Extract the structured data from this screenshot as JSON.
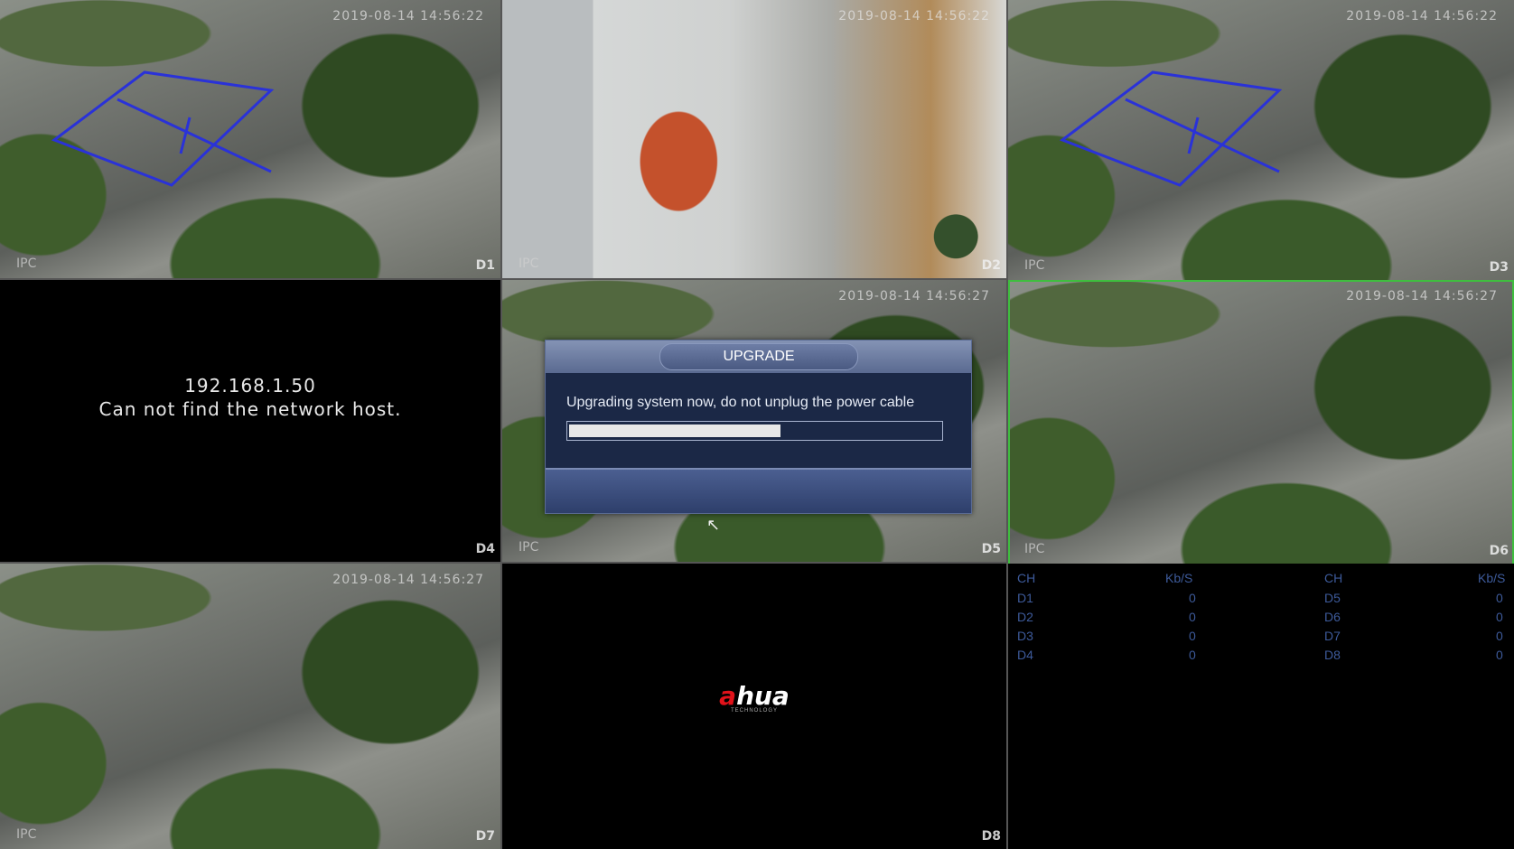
{
  "channels": {
    "d1": {
      "timestamp": "2019-08-14 14:56:22",
      "source": "IPC",
      "label": "D1"
    },
    "d2": {
      "timestamp": "2019-08-14 14:56:22",
      "source": "IPC",
      "label": "D2"
    },
    "d3": {
      "timestamp": "2019-08-14 14:56:22",
      "source": "IPC",
      "label": "D3"
    },
    "d4": {
      "label": "D4",
      "ip": "192.168.1.50",
      "error": "Can not find the network host."
    },
    "d5": {
      "timestamp": "2019-08-14 14:56:27",
      "source": "IPC",
      "label": "D5"
    },
    "d6": {
      "timestamp": "2019-08-14 14:56:27",
      "source": "IPC",
      "label": "D6"
    },
    "d7": {
      "timestamp": "2019-08-14 14:56:27",
      "source": "IPC",
      "label": "D7"
    },
    "d8": {
      "label": "D8",
      "logo": "hua",
      "logo_accent": "a",
      "logo_sub": "TECHNOLOGY"
    }
  },
  "bitrate": {
    "header_ch": "CH",
    "header_kbs": "Kb/S",
    "left": [
      {
        "ch": "D1",
        "kbs": "0"
      },
      {
        "ch": "D2",
        "kbs": "0"
      },
      {
        "ch": "D3",
        "kbs": "0"
      },
      {
        "ch": "D4",
        "kbs": "0"
      }
    ],
    "right": [
      {
        "ch": "D5",
        "kbs": "0"
      },
      {
        "ch": "D6",
        "kbs": "0"
      },
      {
        "ch": "D7",
        "kbs": "0"
      },
      {
        "ch": "D8",
        "kbs": "0"
      }
    ]
  },
  "dialog": {
    "title": "UPGRADE",
    "message": "Upgrading system now, do not unplug the power cable",
    "progress": 0.57
  },
  "colors": {
    "selected_border": "#3fbe3f",
    "dialog_bg": "#1b2846",
    "logo_accent": "#e1121a",
    "bitrate_text": "#3d5a9a"
  },
  "icons": {
    "cursor": "mouse-pointer-icon"
  }
}
